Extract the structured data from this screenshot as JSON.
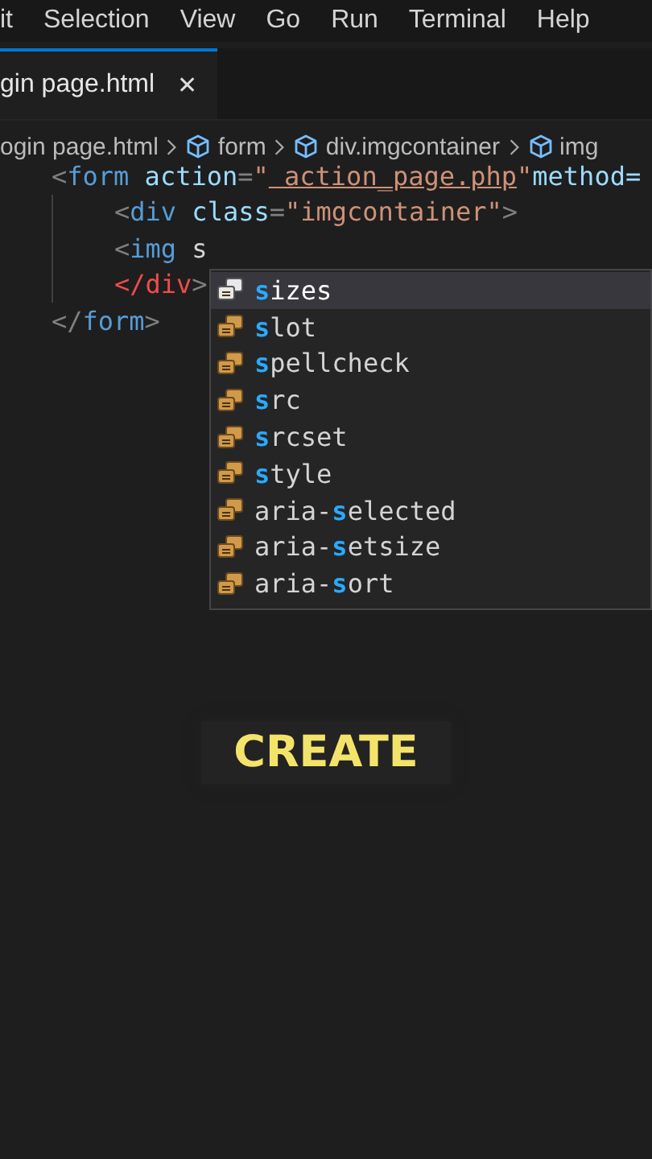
{
  "menu_bar": [
    "it",
    "Selection",
    "View",
    "Go",
    "Run",
    "Terminal",
    "Help"
  ],
  "tabs": [
    {
      "label": "gin page.html",
      "selected": true,
      "close": "✕"
    }
  ],
  "breadcrumb": [
    {
      "label": "ogin page.html",
      "kind": "file"
    },
    {
      "label": "form",
      "kind": "symbol"
    },
    {
      "label": "div.imgcontainer",
      "kind": "symbol"
    },
    {
      "label": "img",
      "kind": "symbol"
    }
  ],
  "code_lines": [
    {
      "tokens": [
        {
          "kind": "punct",
          "text": "<"
        },
        {
          "kind": "tag",
          "text": "form"
        },
        {
          "kind": "attr",
          "text": " action"
        },
        {
          "kind": "punct",
          "text": "="
        },
        {
          "kind": "string",
          "text": "\""
        },
        {
          "kind": "link",
          "text": " action_page.php"
        },
        {
          "kind": "string",
          "text": "\""
        },
        {
          "kind": "attr",
          "text": "method="
        }
      ],
      "children": [
        {
          "tokens": [
            {
              "kind": "punct",
              "text": "<"
            },
            {
              "kind": "tag",
              "text": "div"
            },
            {
              "kind": "attr",
              "text": " class"
            },
            {
              "kind": "punct",
              "text": "="
            },
            {
              "kind": "string",
              "text": "\"imgcontainer\""
            },
            {
              "kind": "punct",
              "text": ">"
            }
          ]
        },
        {
          "tokens": [
            {
              "kind": "punct",
              "text": "<"
            },
            {
              "kind": "tag",
              "text": "img"
            },
            {
              "kind": "plain",
              "text": " s"
            }
          ]
        },
        {
          "tokens": [
            {
              "kind": "error",
              "text": "</div"
            },
            {
              "kind": "punct",
              "text": ">"
            }
          ]
        }
      ]
    },
    {
      "tokens": [
        {
          "kind": "punct",
          "text": "</"
        },
        {
          "kind": "tag",
          "text": "form"
        },
        {
          "kind": "punct",
          "text": ">"
        }
      ]
    }
  ],
  "suggestions": [
    {
      "match": "s",
      "after": "izes",
      "selected": true
    },
    {
      "match": "s",
      "after": "lot",
      "selected": false
    },
    {
      "match": "s",
      "after": "pellcheck",
      "selected": false
    },
    {
      "match": "s",
      "after": "rc",
      "selected": false
    },
    {
      "match": "s",
      "after": "rcset",
      "selected": false
    },
    {
      "match": "s",
      "after": "tyle",
      "selected": false
    },
    {
      "before": "aria-",
      "match": "s",
      "after": "elected",
      "selected": false
    },
    {
      "before": "aria-",
      "match": "s",
      "after": "etsize",
      "selected": false
    },
    {
      "before": "aria-",
      "match": "s",
      "after": "ort",
      "selected": false
    }
  ],
  "caption": "CREATE"
}
